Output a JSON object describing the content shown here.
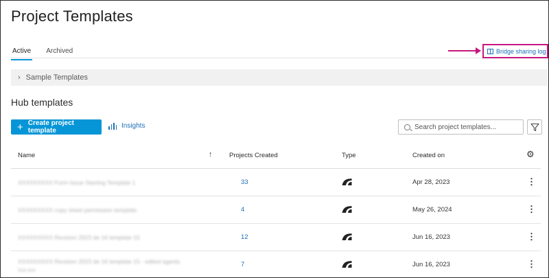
{
  "header": {
    "title": "Project Templates"
  },
  "tabs": [
    {
      "label": "Active",
      "active": true
    },
    {
      "label": "Archived",
      "active": false
    }
  ],
  "bridge_link": {
    "label": "Bridge sharing log",
    "icon": "book-icon",
    "highlight_color": "#c7157f"
  },
  "sample_section": {
    "label": "Sample Templates",
    "icon": "chevron-right-icon"
  },
  "hub": {
    "title": "Hub templates",
    "create_label": "Create project template",
    "insights_label": "Insights",
    "search_placeholder": "Search project templates...",
    "accent_color": "#0696d7"
  },
  "table": {
    "columns": [
      "Name",
      "Projects Created",
      "Type",
      "Created on"
    ],
    "rows": [
      {
        "name": "XXXXXXXXX Form Issue Starting Template 1",
        "name_sub": "",
        "projects_created": "33",
        "type_icon": "bridge-logo-icon",
        "created_on": "Apr 28, 2023"
      },
      {
        "name": "XXXXXXXXX copy sheet permission template",
        "name_sub": "",
        "projects_created": "4",
        "type_icon": "bridge-logo-icon",
        "created_on": "May 26, 2024"
      },
      {
        "name": "XXXXXXXXX Revision 2023 de 16 template 15",
        "name_sub": "",
        "projects_created": "12",
        "type_icon": "bridge-logo-icon",
        "created_on": "Jun 16, 2023"
      },
      {
        "name": "XXXXXXXXX Revision 2023 de 16 template 15 - edited agents",
        "name_sub": "Sub text",
        "projects_created": "7",
        "type_icon": "bridge-logo-icon",
        "created_on": "Jun 16, 2023"
      }
    ]
  }
}
